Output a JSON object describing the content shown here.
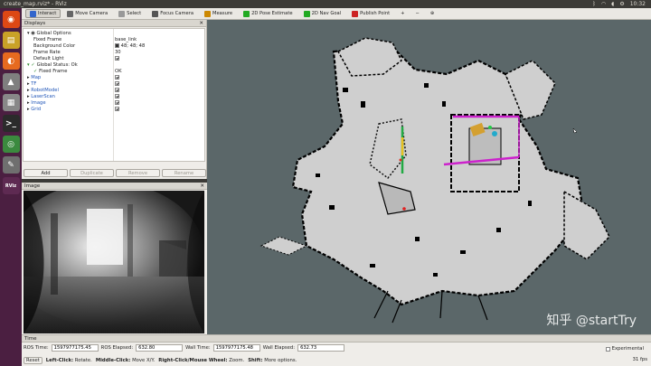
{
  "os": {
    "window_title": "create_map.rviz* - RViz",
    "clock": "10:32",
    "tray_icons": [
      "bluetooth-icon",
      "wifi-icon",
      "sound-icon",
      "settings-icon"
    ]
  },
  "launcher": [
    {
      "name": "dash-icon",
      "glyph": "◉",
      "color": "#dd4814"
    },
    {
      "name": "files-icon",
      "glyph": "▤",
      "color": "#c9a227"
    },
    {
      "name": "browser-icon",
      "glyph": "◐",
      "color": "#e66a1f"
    },
    {
      "name": "software-icon",
      "glyph": "▲",
      "color": "#7f7f7f"
    },
    {
      "name": "text-editor-icon",
      "glyph": "▦",
      "color": "#888"
    },
    {
      "name": "terminal-icon",
      "glyph": ">_",
      "color": "#2b2b2b"
    },
    {
      "name": "chrome-icon",
      "glyph": "◎",
      "color": "#3b8a3e"
    },
    {
      "name": "edit-icon",
      "glyph": "✎",
      "color": "#6f6f6f"
    },
    {
      "name": "rviz-icon",
      "glyph": "RViz",
      "color": "#5e2a52"
    }
  ],
  "toolbar": [
    {
      "label": "Interact",
      "icon": "interact-icon",
      "color": "#3366cc",
      "active": true
    },
    {
      "label": "Move Camera",
      "icon": "move-camera-icon",
      "color": "#666"
    },
    {
      "label": "Select",
      "icon": "select-icon",
      "color": "#999"
    },
    {
      "label": "Focus Camera",
      "icon": "focus-camera-icon",
      "color": "#555"
    },
    {
      "label": "Measure",
      "icon": "measure-icon",
      "color": "#cc8800"
    },
    {
      "label": "2D Pose Estimate",
      "icon": "pose-estimate-icon",
      "color": "#22aa22"
    },
    {
      "label": "2D Nav Goal",
      "icon": "nav-goal-icon",
      "color": "#22aa22"
    },
    {
      "label": "Publish Point",
      "icon": "publish-point-icon",
      "color": "#cc2222"
    }
  ],
  "view_controls": [
    "+",
    "−",
    "⊕"
  ],
  "displays": {
    "title": "Displays",
    "rows": [
      {
        "key": "Global Options",
        "value": "",
        "indent": 1,
        "kind": "header"
      },
      {
        "key": "Fixed Frame",
        "value": "base_link",
        "indent": 2
      },
      {
        "key": "Background Color",
        "value": "48; 48; 48",
        "indent": 2,
        "swatch": "#303030"
      },
      {
        "key": "Frame Rate",
        "value": "30",
        "indent": 2
      },
      {
        "key": "Default Light",
        "value": "",
        "indent": 2,
        "check": true
      },
      {
        "key": "Global Status: Ok",
        "value": "",
        "indent": 1,
        "kind": "ok"
      },
      {
        "key": "Fixed Frame",
        "value": "OK",
        "indent": 2,
        "kind": "ok"
      },
      {
        "key": "Map",
        "value": "",
        "indent": 1,
        "kind": "display",
        "check": true
      },
      {
        "key": "TF",
        "value": "",
        "indent": 1,
        "kind": "display",
        "check": true
      },
      {
        "key": "RobotModel",
        "value": "",
        "indent": 1,
        "kind": "display",
        "check": true
      },
      {
        "key": "LaserScan",
        "value": "",
        "indent": 1,
        "kind": "display",
        "check": true
      },
      {
        "key": "Image",
        "value": "",
        "indent": 1,
        "kind": "display",
        "check": true
      },
      {
        "key": "Grid",
        "value": "",
        "indent": 1,
        "kind": "display",
        "check": true
      }
    ],
    "buttons": [
      {
        "label": "Add",
        "enabled": true
      },
      {
        "label": "Duplicate",
        "enabled": false
      },
      {
        "label": "Remove",
        "enabled": false
      },
      {
        "label": "Rename",
        "enabled": false
      }
    ]
  },
  "image_panel": {
    "title": "Image"
  },
  "time_panel": {
    "title": "Time",
    "ros_time_label": "ROS Time:",
    "ros_time": "1597977175.45",
    "ros_elapsed_label": "ROS Elapsed:",
    "ros_elapsed": "632.80",
    "wall_time_label": "Wall Time:",
    "wall_time": "1597977175.48",
    "wall_elapsed_label": "Wall Elapsed:",
    "wall_elapsed": "632.73",
    "experimental_label": "Experimental"
  },
  "status_bar": {
    "reset": "Reset",
    "left_click": "Left-Click:",
    "left_click_desc": "Rotate.",
    "middle_click": "Middle-Click:",
    "middle_click_desc": "Move X/Y.",
    "right_click": "Right-Click/Mouse Wheel:",
    "right_click_desc": "Zoom.",
    "shift": "Shift:",
    "shift_desc": "More options.",
    "fps": "31 fps"
  },
  "watermark": "知乎 @startTry",
  "colors": {
    "map_unknown": "#5b6769",
    "map_free": "#d0d0d0",
    "map_occupied": "#000000",
    "laser": "#cc22cc"
  }
}
